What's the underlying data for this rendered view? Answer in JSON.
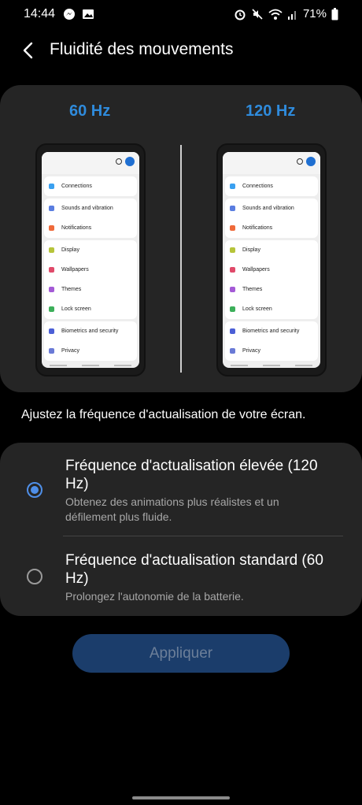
{
  "status": {
    "time": "14:44",
    "battery": "71%",
    "left_icons": [
      "messenger-icon",
      "gallery-icon"
    ],
    "right_icons": [
      "alarm-icon",
      "mute-icon",
      "wifi-icon",
      "signal-icon",
      "battery-icon"
    ]
  },
  "header": {
    "title": "Fluidité des mouvements"
  },
  "preview": {
    "left_label": "60 Hz",
    "right_label": "120 Hz",
    "phone_groups": [
      [
        "Connections"
      ],
      [
        "Sounds and vibration",
        "Notifications"
      ],
      [
        "Display",
        "Wallpapers",
        "Themes",
        "Lock screen"
      ],
      [
        "Biometrics and security",
        "Privacy"
      ]
    ],
    "icon_colors": [
      "#3aa0f0",
      "#5a7de0",
      "#ef6a3a",
      "#b6c43a",
      "#e04a6a",
      "#a45ad6",
      "#3caf5a",
      "#4b5fd6",
      "#6a7ad6"
    ]
  },
  "description": "Ajustez la fréquence d'actualisation de votre écran.",
  "options": [
    {
      "title": "Fréquence d'actualisation élevée (120 Hz)",
      "subtitle": "Obtenez des animations plus réalistes et un défilement plus fluide.",
      "selected": true
    },
    {
      "title": "Fréquence d'actualisation standard (60 Hz)",
      "subtitle": "Prolongez l'autonomie de la batterie.",
      "selected": false
    }
  ],
  "apply_label": "Appliquer",
  "colors": {
    "accent": "#2f8bdc",
    "radio": "#4f8fe8",
    "card": "#252525"
  }
}
